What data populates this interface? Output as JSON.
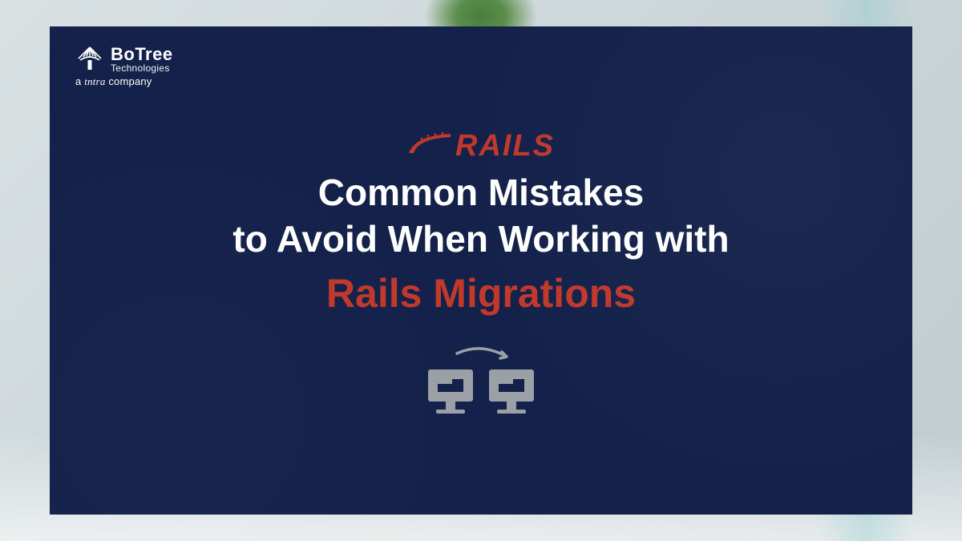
{
  "logo": {
    "brand_line1": "BoTree",
    "brand_line2": "Technologies",
    "tagline_prefix": "a ",
    "tagline_script": "tntra",
    "tagline_suffix": " company"
  },
  "rails": {
    "label": "RAILS"
  },
  "hero": {
    "line1": "Common Mistakes",
    "line2": "to Avoid When Working with",
    "highlight": "Rails Migrations"
  },
  "colors": {
    "panel_bg": "#14214a",
    "accent_red": "#c0392b",
    "icon_gray": "#9aa0a6"
  }
}
